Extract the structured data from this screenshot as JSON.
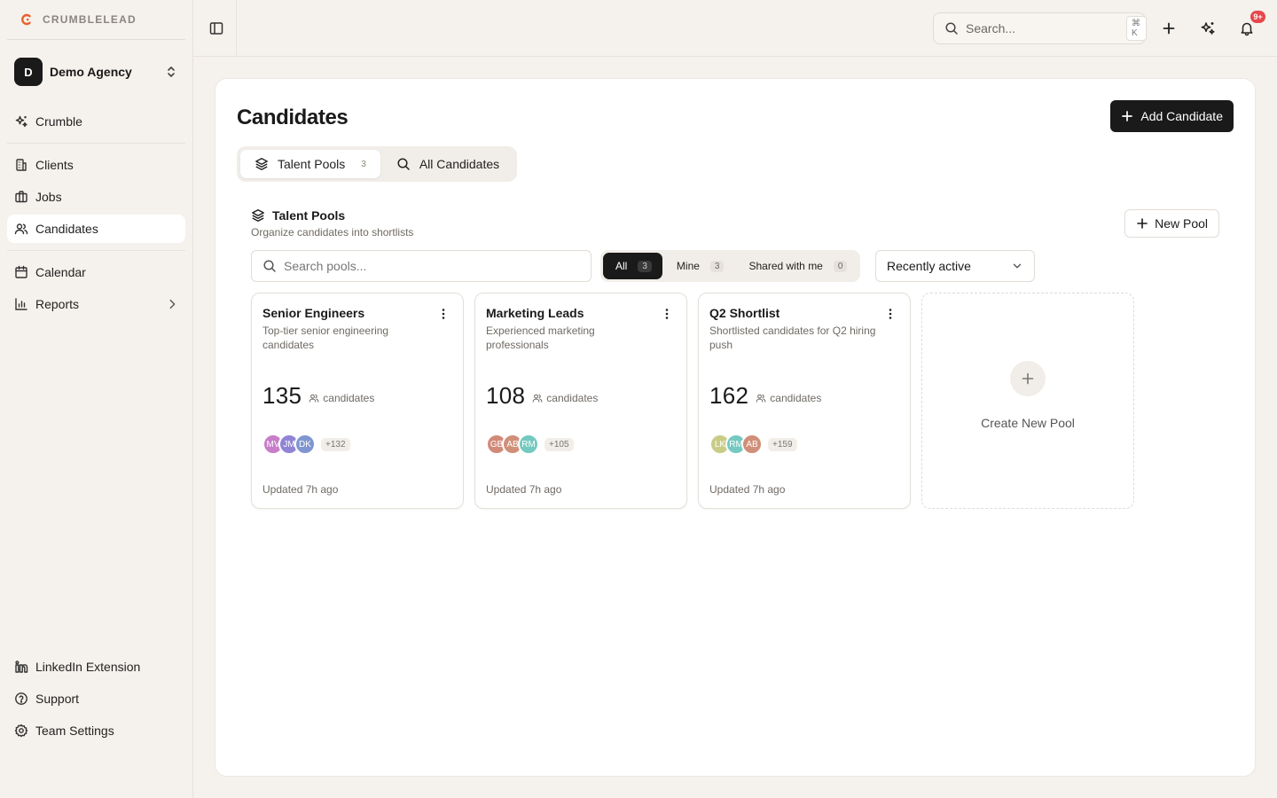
{
  "brand": {
    "name": "CRUMBLELEAD",
    "accent": "#e8612c"
  },
  "agency": {
    "initial": "D",
    "name": "Demo Agency"
  },
  "sidebar": {
    "top_items": [
      {
        "label": "Crumble",
        "icon": "sparkle-icon"
      }
    ],
    "items": [
      {
        "label": "Clients",
        "icon": "building-icon"
      },
      {
        "label": "Jobs",
        "icon": "briefcase-icon"
      },
      {
        "label": "Candidates",
        "icon": "users-icon",
        "active": true
      },
      {
        "label": "Calendar",
        "icon": "calendar-icon"
      },
      {
        "label": "Reports",
        "icon": "bar-chart-icon"
      }
    ],
    "bottom_items": [
      {
        "label": "LinkedIn Extension",
        "icon": "linkedin-icon"
      },
      {
        "label": "Support",
        "icon": "help-circle-icon"
      },
      {
        "label": "Team Settings",
        "icon": "gear-icon"
      }
    ]
  },
  "topbar": {
    "search_placeholder": "Search...",
    "search_shortcut": "⌘ K",
    "notification_badge": "9+",
    "badge_color": "#e5484d"
  },
  "page": {
    "title": "Candidates",
    "add_button": "Add Candidate",
    "tabs": [
      {
        "label": "Talent Pools",
        "count": "3",
        "active": true
      },
      {
        "label": "All Candidates"
      }
    ]
  },
  "pools": {
    "title": "Talent Pools",
    "subtitle": "Organize candidates into shortlists",
    "new_button": "New Pool",
    "search_placeholder": "Search pools...",
    "filters": [
      {
        "label": "All",
        "count": "3",
        "active": true
      },
      {
        "label": "Mine",
        "count": "3"
      },
      {
        "label": "Shared with me",
        "count": "0"
      }
    ],
    "sort_value": "Recently active",
    "candidates_label": "candidates",
    "cards": [
      {
        "name": "Senior Engineers",
        "description": "Top-tier senior engineering candidates",
        "count": "135",
        "avatars": [
          {
            "initials": "MV",
            "color": "#c77dc9"
          },
          {
            "initials": "JM",
            "color": "#8f84d6"
          },
          {
            "initials": "DK",
            "color": "#7f96d0"
          }
        ],
        "more": "+132",
        "updated": "Updated 7h ago"
      },
      {
        "name": "Marketing Leads",
        "description": "Experienced marketing professionals",
        "count": "108",
        "avatars": [
          {
            "initials": "GB",
            "color": "#d18a7a"
          },
          {
            "initials": "AB",
            "color": "#d08f78"
          },
          {
            "initials": "RM",
            "color": "#74c9c0"
          }
        ],
        "more": "+105",
        "updated": "Updated 7h ago"
      },
      {
        "name": "Q2 Shortlist",
        "description": "Shortlisted candidates for Q2 hiring push",
        "count": "162",
        "avatars": [
          {
            "initials": "LK",
            "color": "#c9cc85"
          },
          {
            "initials": "RM",
            "color": "#74c9c0"
          },
          {
            "initials": "AB",
            "color": "#d08f78"
          }
        ],
        "more": "+159",
        "updated": "Updated 7h ago"
      }
    ],
    "create_label": "Create New Pool"
  }
}
